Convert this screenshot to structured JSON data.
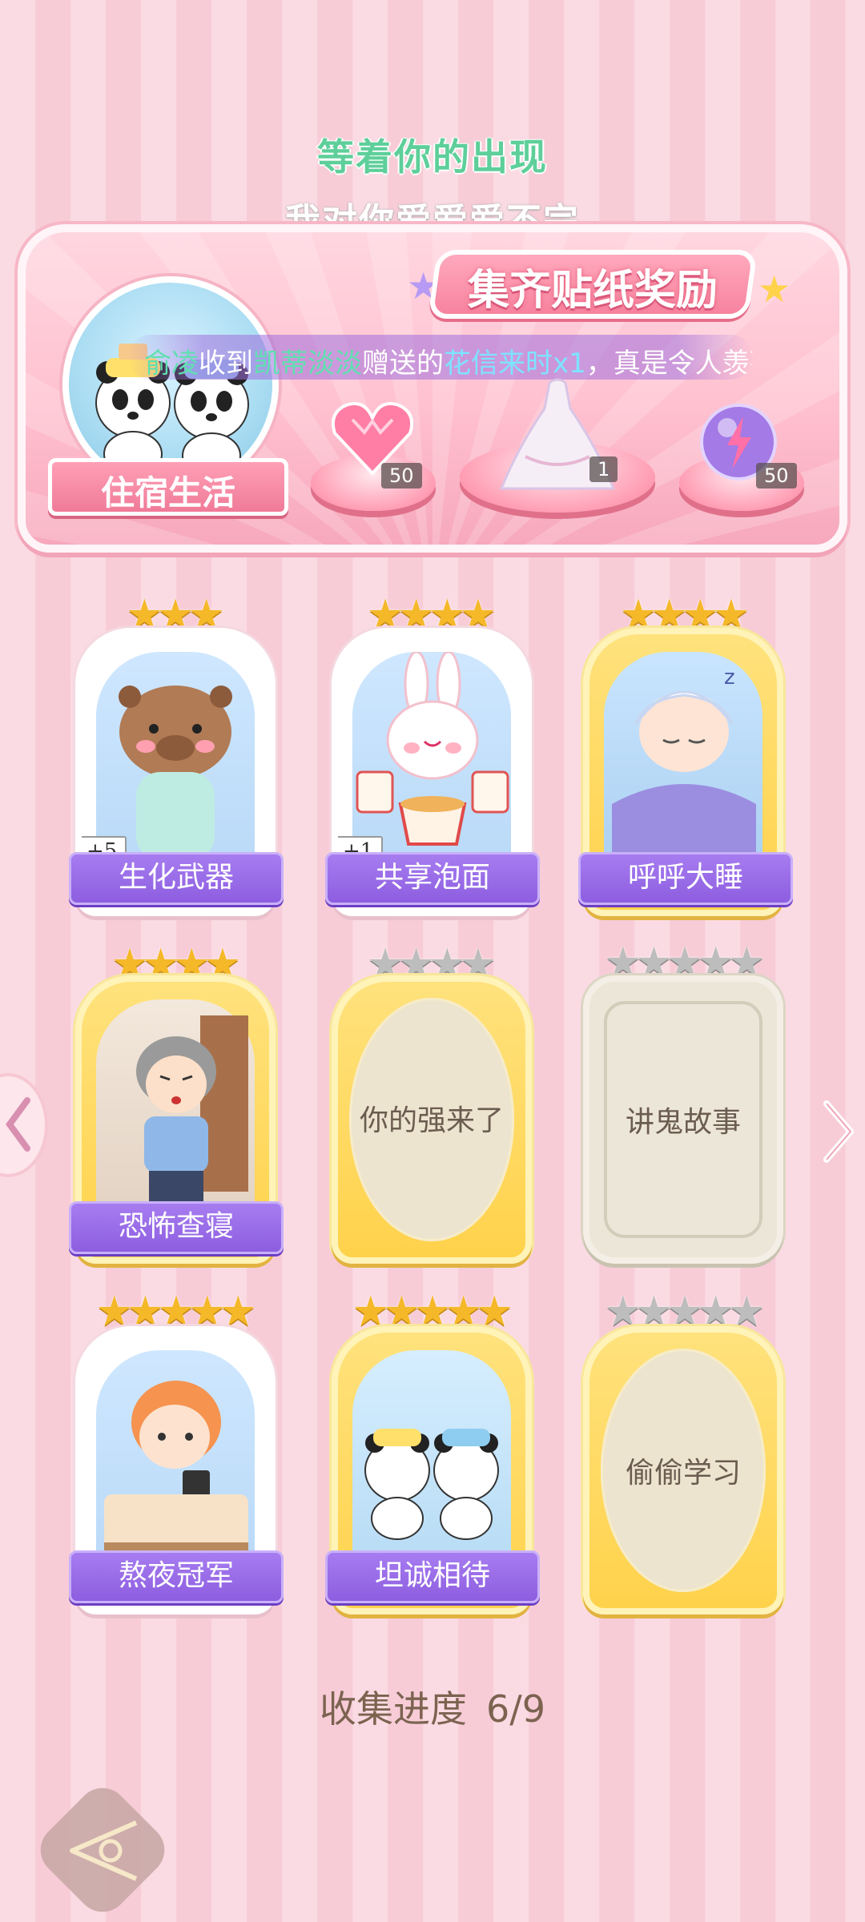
{
  "header": {
    "line1": "等着你的出现",
    "line2": "我对你爱爱爱不完"
  },
  "banner": {
    "title": "集齐贴纸奖励",
    "dorm_label": "住宿生活",
    "marquee": {
      "part1": "俞凌",
      "part2": "收到",
      "part3": "凯蒂淡淡",
      "part4": "赠送的",
      "part5": "花信来时x1",
      "part6": "，真是令人羡慕"
    },
    "rewards": [
      {
        "name": "heart-gem",
        "count": "50"
      },
      {
        "name": "dress",
        "count": "1"
      },
      {
        "name": "energy-orb",
        "count": "50"
      }
    ]
  },
  "cards": [
    {
      "label": "生化武器",
      "stars": 3,
      "stars_total": 3,
      "state": "collected",
      "plus": "+5"
    },
    {
      "label": "共享泡面",
      "stars": 4,
      "stars_total": 4,
      "state": "collected",
      "plus": "+1"
    },
    {
      "label": "呼呼大睡",
      "stars": 4,
      "stars_total": 4,
      "state": "collected",
      "plus": ""
    },
    {
      "label": "恐怖查寝",
      "stars": 4,
      "stars_total": 4,
      "state": "collected",
      "plus": ""
    },
    {
      "label": "你的强来了",
      "stars": 0,
      "stars_total": 4,
      "state": "locked",
      "plus": ""
    },
    {
      "label": "讲鬼故事",
      "stars": 0,
      "stars_total": 5,
      "state": "locked",
      "plus": ""
    },
    {
      "label": "熬夜冠军",
      "stars": 5,
      "stars_total": 5,
      "state": "collected",
      "plus": ""
    },
    {
      "label": "坦诚相待",
      "stars": 5,
      "stars_total": 5,
      "state": "collected",
      "plus": ""
    },
    {
      "label": "偷偷学习",
      "stars": 0,
      "stars_total": 5,
      "state": "locked",
      "plus": ""
    }
  ],
  "progress": {
    "label": "收集进度",
    "value": "6/9"
  },
  "colors": {
    "label_purple": "#8d5ee0",
    "star_gold": "#f5b829",
    "star_gray": "#bdbdbd",
    "background_pink": "#fbdbe3"
  }
}
